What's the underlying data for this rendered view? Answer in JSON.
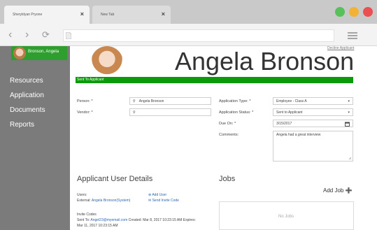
{
  "browser": {
    "tabs": [
      {
        "label": "Sheryldyan Pryone",
        "active": true
      },
      {
        "label": "New Tab",
        "active": false
      }
    ],
    "window_controls_colors": {
      "green": "#5ac05a",
      "yellow": "#f2b233",
      "red": "#ec4f4f"
    }
  },
  "sidebar": {
    "user_name": "Bronson, Angela",
    "items": [
      "Resources",
      "Application",
      "Documents",
      "Reports"
    ]
  },
  "header": {
    "name": "Angela Bronson",
    "decline_link": "Decline Applicant",
    "status_bar": "Sent To Applicant"
  },
  "form": {
    "person": {
      "label": "Person: *",
      "value": "Angela Bronson"
    },
    "vendor": {
      "label": "Vendor: *",
      "value": ""
    },
    "application_type": {
      "label": "Application Type: *",
      "value": "Employee - Class A"
    },
    "application_status": {
      "label": "Application Status: *",
      "value": "Sent to Applicant"
    },
    "due_on": {
      "label": "Due On: *",
      "value": "3/15/2017"
    },
    "comments": {
      "label": "Comments:",
      "value": "Angela had a great interview"
    }
  },
  "applicant_user_details": {
    "title": "Applicant User Details",
    "users_label": "Users:",
    "external_prefix": "External:",
    "external_value": "Angela Bronson(System)",
    "add_user": "Add User",
    "send_invite_code": "Send Invite Code",
    "invite_codes_label": "Invite Codes",
    "sent_to_prefix": "Sent To:",
    "sent_to_email": "Angel23@myemail.com",
    "created_prefix": "Created:",
    "created_value": "Mar 8, 2017 10:23:15 AM",
    "expires_prefix": "Expires:",
    "expires_value": "Mar 11, 2017 10:23:15 AM"
  },
  "jobs": {
    "title": "Jobs",
    "add_job": "Add Job",
    "empty": "No Jobs"
  },
  "accent_green": "#0a9a0a"
}
